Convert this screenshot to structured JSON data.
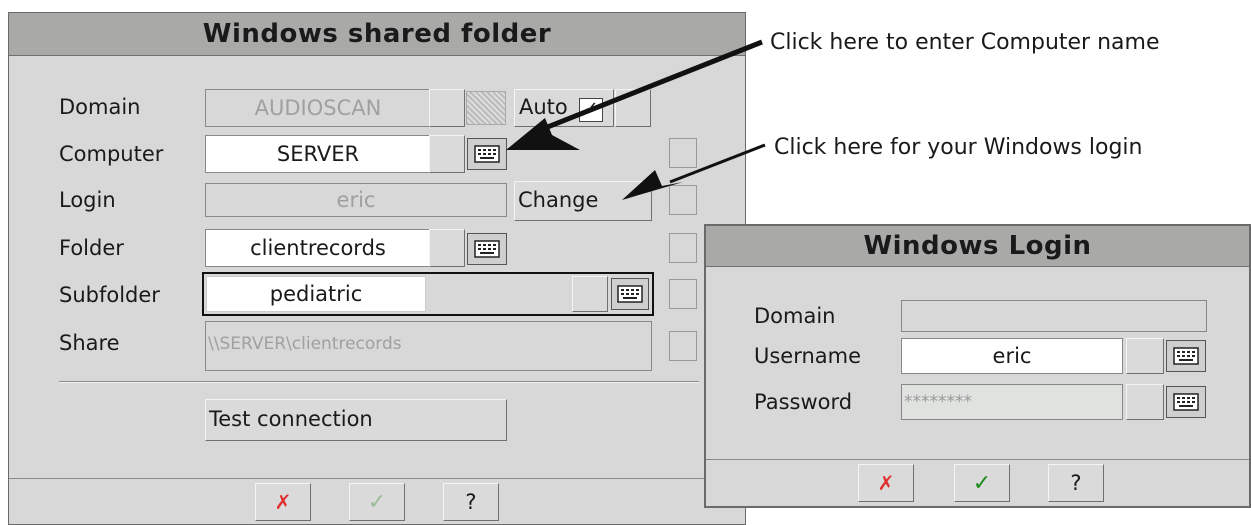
{
  "annotations": {
    "computer_name": "Click here to enter Computer name",
    "windows_login": "Click here for your Windows login"
  },
  "shared_folder_dialog": {
    "title": "Windows shared folder",
    "domain": {
      "label": "Domain",
      "value": "AUDIOSCAN"
    },
    "auto": {
      "label": "Auto",
      "checked": true
    },
    "computer": {
      "label": "Computer",
      "value": "SERVER"
    },
    "login": {
      "label": "Login",
      "value": "eric"
    },
    "change_label": "Change",
    "folder": {
      "label": "Folder",
      "value": "clientrecords"
    },
    "subfolder": {
      "label": "Subfolder",
      "value": "pediatric"
    },
    "share": {
      "label": "Share",
      "value": "\\\\SERVER\\clientrecords"
    },
    "test_connection_label": "Test connection",
    "buttons": {
      "cancel": "✗",
      "ok": "✓",
      "help": "?"
    }
  },
  "login_dialog": {
    "title": "Windows Login",
    "domain": {
      "label": "Domain",
      "value": ""
    },
    "username": {
      "label": "Username",
      "value": "eric"
    },
    "password": {
      "label": "Password",
      "value": "********"
    },
    "buttons": {
      "cancel": "✗",
      "ok": "✓",
      "help": "?"
    }
  },
  "colors": {
    "cancel": "#e03030",
    "ok": "#1f8a1f",
    "title_bar": "#a9aaa8",
    "dialog_bg": "#d8d8d8"
  },
  "icons": [
    "keyboard-icon",
    "check-icon",
    "cancel-icon",
    "help-icon",
    "arrow-icon"
  ]
}
